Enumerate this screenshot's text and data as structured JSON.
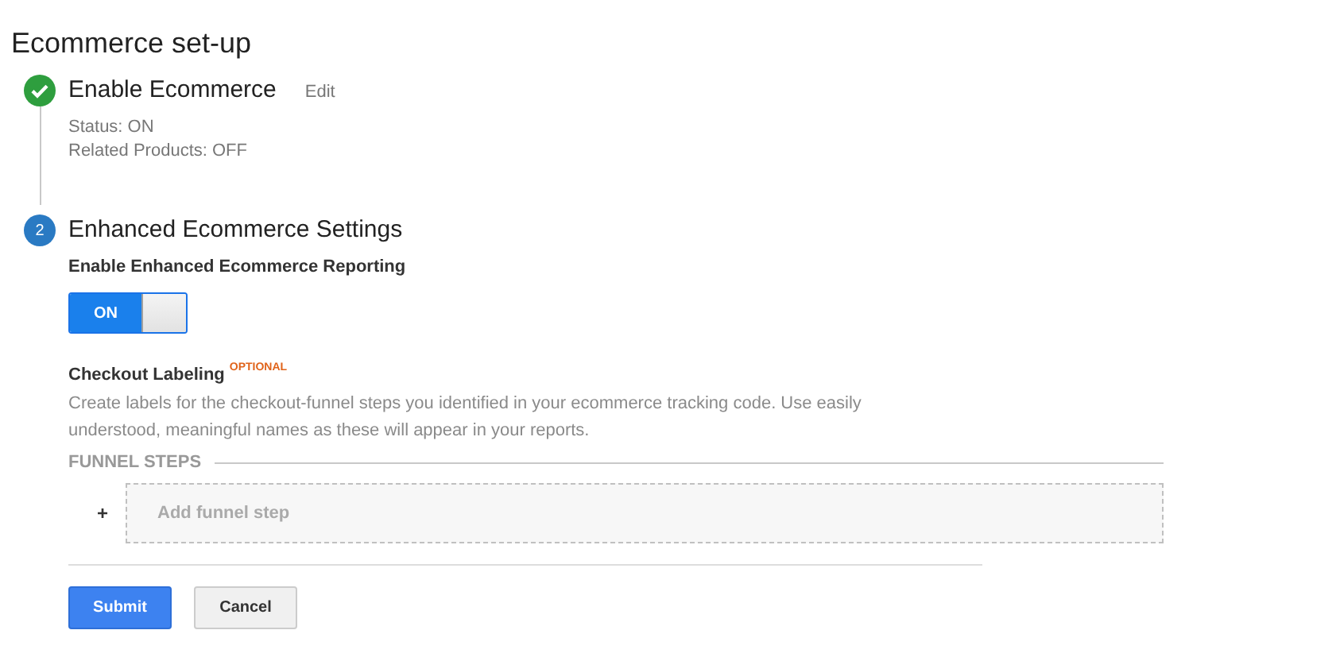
{
  "title": "Ecommerce set-up",
  "steps": [
    {
      "kind": "done",
      "title": "Enable Ecommerce",
      "edit_link": "Edit",
      "details": [
        "Status: ON",
        "Related Products: OFF"
      ]
    },
    {
      "kind": "numbered",
      "number": "2",
      "title": "Enhanced Ecommerce Settings",
      "reporting": {
        "label": "Enable Enhanced Ecommerce Reporting",
        "toggle": {
          "label": "ON",
          "on": true
        }
      },
      "checkout": {
        "title": "Checkout Labeling",
        "badge": "OPTIONAL",
        "description": "Create labels for the checkout-funnel steps you identified in your ecommerce tracking code. Use easily understood, meaningful names as these will appear in your reports.",
        "funnel_heading": "FUNNEL STEPS",
        "add_icon": "+",
        "add_placeholder": "Add funnel step"
      }
    }
  ],
  "buttons": [
    {
      "label": "Submit",
      "kind": "primary"
    },
    {
      "label": "Cancel",
      "kind": "secondary"
    }
  ]
}
